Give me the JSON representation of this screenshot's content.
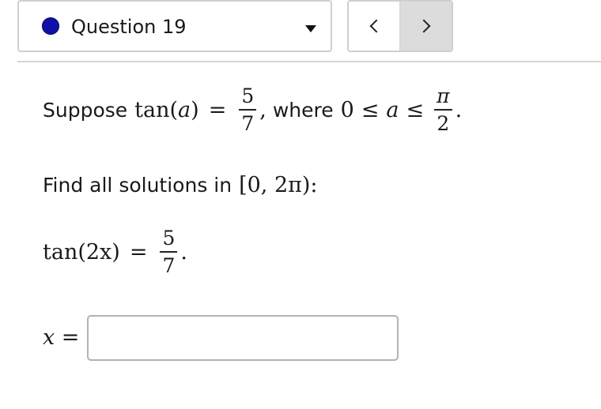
{
  "question_selector": {
    "label": "Question 19",
    "dot_color": "#1010a8"
  },
  "nav": {
    "prev_icon": "chevron-left-icon",
    "next_icon": "chevron-right-icon"
  },
  "problem": {
    "line1": {
      "suppose": "Suppose",
      "tan_a": "tan(",
      "a": "a",
      "close": ")",
      "eq": "=",
      "frac_num": "5",
      "frac_den": "7",
      "comma": ",",
      "where": "where",
      "zero": "0",
      "le1": "≤",
      "a2": "a",
      "le2": "≤",
      "pi_num": "π",
      "pi_den": "2",
      "period": "."
    },
    "line2": {
      "text": "Find all solutions in",
      "interval": "[0, 2π):"
    },
    "line3": {
      "lhs": "tan(2x)",
      "eq": "=",
      "frac_num": "5",
      "frac_den": "7",
      "period": "."
    }
  },
  "answer": {
    "label": "x =",
    "value": "",
    "placeholder": ""
  }
}
